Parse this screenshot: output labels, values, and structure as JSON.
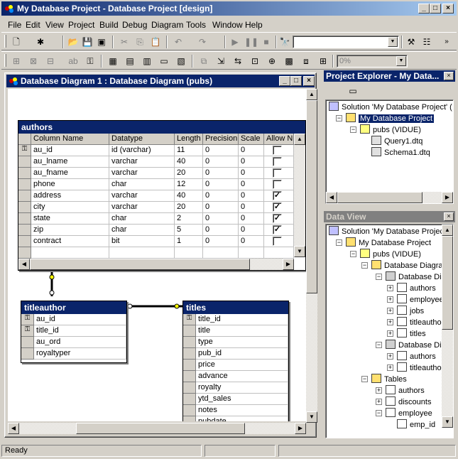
{
  "app": {
    "title": "My Database Project - Database Project [design]",
    "min": "_",
    "max": "□",
    "close": "×"
  },
  "menu": [
    "File",
    "Edit",
    "View",
    "Project",
    "Build",
    "Debug",
    "Diagram",
    "Tools",
    "Window",
    "Help"
  ],
  "toolbar": {
    "zoom_value": "0%"
  },
  "diagram_window": {
    "title": "Database Diagram 1 : Database Diagram (pubs)"
  },
  "authors": {
    "name": "authors",
    "columns": [
      "Column Name",
      "Datatype",
      "Length",
      "Precision",
      "Scale",
      "Allow Nulls"
    ],
    "rows": [
      {
        "key": true,
        "name": "au_id",
        "type": "id (varchar)",
        "length": "11",
        "precision": "0",
        "scale": "0",
        "nulls": false
      },
      {
        "key": false,
        "name": "au_lname",
        "type": "varchar",
        "length": "40",
        "precision": "0",
        "scale": "0",
        "nulls": false
      },
      {
        "key": false,
        "name": "au_fname",
        "type": "varchar",
        "length": "20",
        "precision": "0",
        "scale": "0",
        "nulls": false
      },
      {
        "key": false,
        "name": "phone",
        "type": "char",
        "length": "12",
        "precision": "0",
        "scale": "0",
        "nulls": false
      },
      {
        "key": false,
        "name": "address",
        "type": "varchar",
        "length": "40",
        "precision": "0",
        "scale": "0",
        "nulls": true
      },
      {
        "key": false,
        "name": "city",
        "type": "varchar",
        "length": "20",
        "precision": "0",
        "scale": "0",
        "nulls": true
      },
      {
        "key": false,
        "name": "state",
        "type": "char",
        "length": "2",
        "precision": "0",
        "scale": "0",
        "nulls": true
      },
      {
        "key": false,
        "name": "zip",
        "type": "char",
        "length": "5",
        "precision": "0",
        "scale": "0",
        "nulls": true
      },
      {
        "key": false,
        "name": "contract",
        "type": "bit",
        "length": "1",
        "precision": "0",
        "scale": "0",
        "nulls": false
      }
    ]
  },
  "titleauthor": {
    "name": "titleauthor",
    "rows": [
      {
        "key": true,
        "name": "au_id"
      },
      {
        "key": true,
        "name": "title_id"
      },
      {
        "key": false,
        "name": "au_ord"
      },
      {
        "key": false,
        "name": "royaltyper"
      }
    ]
  },
  "titles": {
    "name": "titles",
    "rows": [
      {
        "key": true,
        "name": "title_id"
      },
      {
        "key": false,
        "name": "title"
      },
      {
        "key": false,
        "name": "type"
      },
      {
        "key": false,
        "name": "pub_id"
      },
      {
        "key": false,
        "name": "price"
      },
      {
        "key": false,
        "name": "advance"
      },
      {
        "key": false,
        "name": "royalty"
      },
      {
        "key": false,
        "name": "ytd_sales"
      },
      {
        "key": false,
        "name": "notes"
      },
      {
        "key": false,
        "name": "pubdate"
      }
    ]
  },
  "project_explorer": {
    "title": "Project Explorer - My Data...",
    "nodes": [
      {
        "label": "Solution 'My Database Project' (",
        "icon": "solution-icon"
      },
      {
        "label": "My Database Project",
        "icon": "project-icon"
      },
      {
        "label": "pubs (VIDUE)",
        "icon": "database-icon"
      },
      {
        "label": "Query1.dtq",
        "icon": "query-file-icon"
      },
      {
        "label": "Schema1.dtq",
        "icon": "query-file-icon"
      }
    ]
  },
  "data_view": {
    "title": "Data View",
    "nodes": [
      {
        "label": "Solution 'My Database Project"
      },
      {
        "label": "My Database Project"
      },
      {
        "label": "pubs (VIDUE)"
      },
      {
        "label": "Database Diagra"
      },
      {
        "label": "Database Dia"
      },
      {
        "label": "authors"
      },
      {
        "label": "employee"
      },
      {
        "label": "jobs"
      },
      {
        "label": "titleautho"
      },
      {
        "label": "titles"
      },
      {
        "label": "Database Dia"
      },
      {
        "label": "authors"
      },
      {
        "label": "titleautho"
      },
      {
        "label": "Tables"
      },
      {
        "label": "authors"
      },
      {
        "label": "discounts"
      },
      {
        "label": "employee"
      },
      {
        "label": "emp_id"
      }
    ]
  },
  "status": {
    "text": "Ready"
  }
}
